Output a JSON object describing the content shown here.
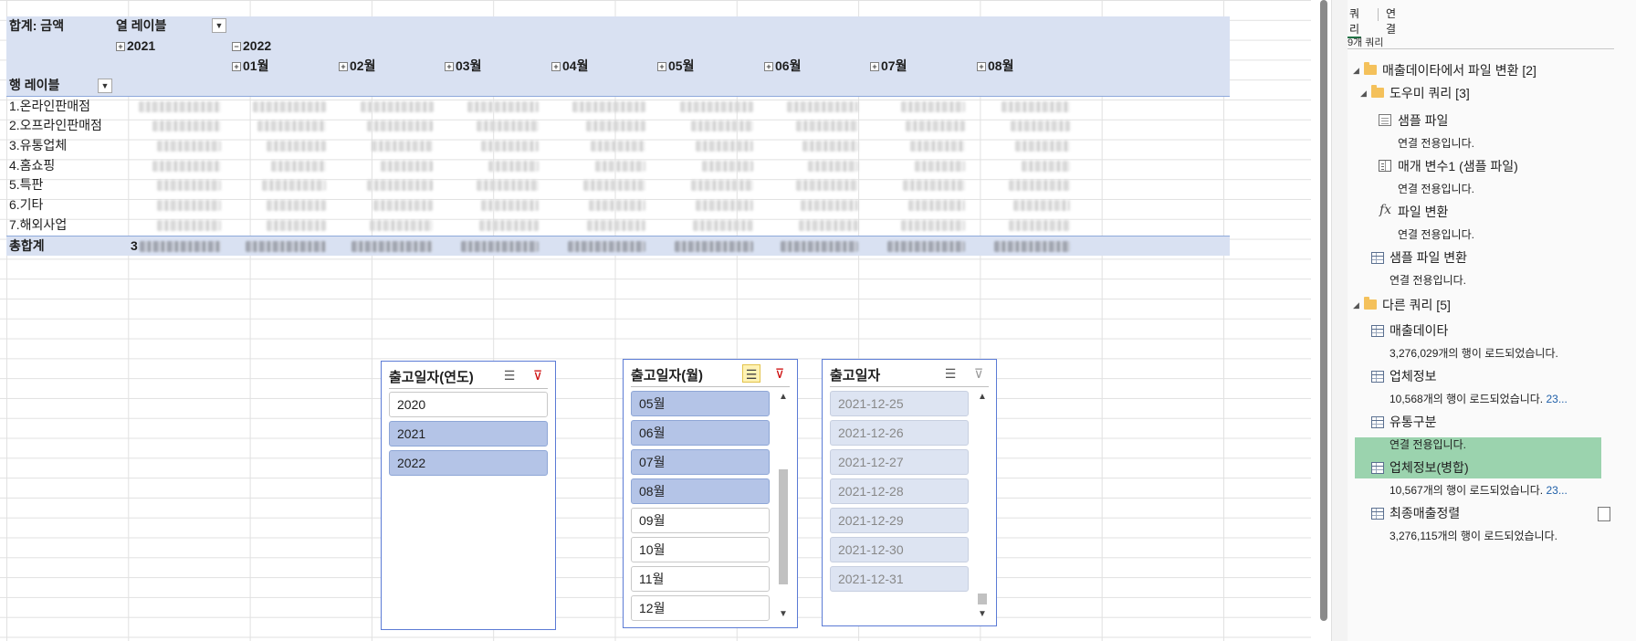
{
  "pivot": {
    "values_label": "합계: 금액",
    "col_labels_label": "열 레이블",
    "row_labels_label": "행 레이블",
    "year_2021": "2021",
    "year_2022": "2022",
    "months": [
      "01월",
      "02월",
      "03월",
      "04월",
      "05월",
      "06월",
      "07월",
      "08월"
    ],
    "rows": [
      "1.온라인판매점",
      "2.오프라인판매점",
      "3.유통업체",
      "4.홈쇼핑",
      "5.특판",
      "6.기타",
      "7.해외사업"
    ],
    "grand_total_label": "총합계",
    "grand_total_prefix": "3"
  },
  "slicers": {
    "year": {
      "title": "출고일자(연도)",
      "items": [
        {
          "label": "2020",
          "selected": false
        },
        {
          "label": "2021",
          "selected": true
        },
        {
          "label": "2022",
          "selected": true
        }
      ]
    },
    "month": {
      "title": "출고일자(월)",
      "items": [
        {
          "label": "05월",
          "selected": true
        },
        {
          "label": "06월",
          "selected": true
        },
        {
          "label": "07월",
          "selected": true
        },
        {
          "label": "08월",
          "selected": true
        },
        {
          "label": "09월",
          "selected": false
        },
        {
          "label": "10월",
          "selected": false
        },
        {
          "label": "11월",
          "selected": false
        },
        {
          "label": "12월",
          "selected": false
        }
      ]
    },
    "date": {
      "title": "출고일자",
      "items": [
        "2021-12-25",
        "2021-12-26",
        "2021-12-27",
        "2021-12-28",
        "2021-12-29",
        "2021-12-30",
        "2021-12-31"
      ]
    }
  },
  "queries_pane": {
    "tabs": [
      "쿼리",
      "연결"
    ],
    "count": "9개 쿼리",
    "group1": "매출데이타에서 파일 변환 [2]",
    "subgroup1": "도우미 쿼리 [3]",
    "group2": "다른 쿼리 [5]",
    "items": [
      {
        "title": "샘플 파일",
        "sub": "연결 전용입니다.",
        "more": ""
      },
      {
        "title": "매개 변수1 (샘플 파일)",
        "sub": "연결 전용입니다.",
        "more": ""
      },
      {
        "title": "파일 변환",
        "sub": "연결 전용입니다.",
        "more": ""
      },
      {
        "title": "샘플 파일 변환",
        "sub": "연결 전용입니다.",
        "more": ""
      },
      {
        "title": "매출데이타",
        "sub": "3,276,029개의 행이 로드되었습니다.",
        "more": ""
      },
      {
        "title": "업체정보",
        "sub": "10,568개의 행이 로드되었습니다.",
        "more": "23..."
      },
      {
        "title": "유통구분",
        "sub": "연결 전용입니다.",
        "more": ""
      },
      {
        "title": "업체정보(병합)",
        "sub": "10,567개의 행이 로드되었습니다.",
        "more": "23..."
      },
      {
        "title": "최종매출정렬",
        "sub": "3,276,115개의 행이 로드되었습니다.",
        "more": ""
      }
    ]
  },
  "colors": {
    "pivot_header": "#d9e1f2",
    "slicer_selected": "#b4c4e7",
    "selected_query": "#9bd3ae"
  }
}
